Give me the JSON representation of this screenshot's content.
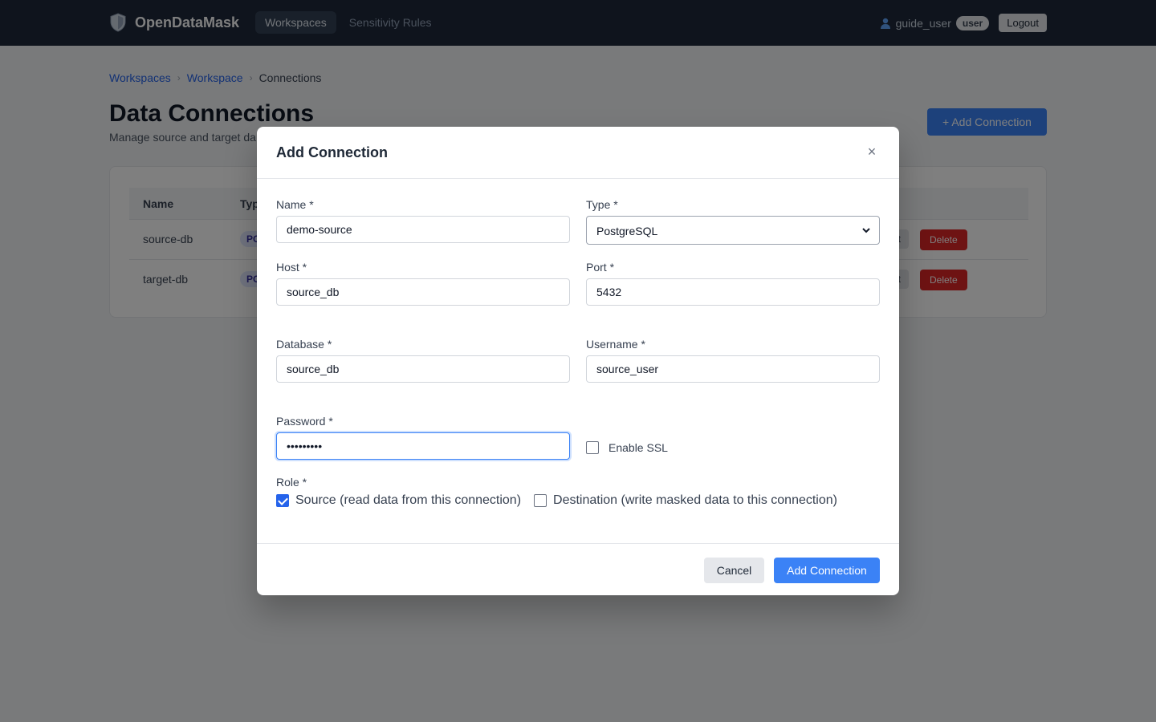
{
  "navbar": {
    "brand": "OpenDataMask",
    "links": [
      {
        "label": "Workspaces",
        "active": true
      },
      {
        "label": "Sensitivity Rules",
        "active": false
      }
    ],
    "username": "guide_user",
    "role_badge": "user",
    "logout_label": "Logout"
  },
  "breadcrumb": {
    "items": [
      "Workspaces",
      "Workspace"
    ],
    "current": "Connections",
    "separator": "›"
  },
  "page": {
    "title": "Data Connections",
    "subtitle": "Manage source and target da",
    "add_button": "+ Add Connection"
  },
  "table": {
    "columns": [
      "Name",
      "Typ"
    ],
    "rows": [
      {
        "name": "source-db",
        "type": "PO",
        "edit": "it",
        "delete": "Delete"
      },
      {
        "name": "target-db",
        "type": "PO",
        "edit": "it",
        "delete": "Delete"
      }
    ]
  },
  "modal": {
    "title": "Add Connection",
    "close_symbol": "×",
    "fields": {
      "name": {
        "label": "Name *",
        "value": "demo-source"
      },
      "type": {
        "label": "Type *",
        "value": "PostgreSQL"
      },
      "host": {
        "label": "Host *",
        "value": "source_db"
      },
      "port": {
        "label": "Port *",
        "value": "5432"
      },
      "database": {
        "label": "Database *",
        "value": "source_db"
      },
      "username": {
        "label": "Username *",
        "value": "source_user"
      },
      "password": {
        "label": "Password *",
        "value": "•••••••••"
      }
    },
    "ssl": {
      "label": "Enable SSL",
      "checked": false
    },
    "role": {
      "label": "Role *",
      "options": [
        {
          "label": "Source (read data from this connection)",
          "checked": true
        },
        {
          "label": "Destination (write masked data to this connection)",
          "checked": false
        }
      ]
    },
    "cancel_label": "Cancel",
    "submit_label": "Add Connection"
  },
  "colors": {
    "navbar_bg": "#1e293b",
    "primary": "#3b82f6",
    "danger": "#dc2626",
    "overlay": "rgba(0,0,0,0.5)"
  }
}
